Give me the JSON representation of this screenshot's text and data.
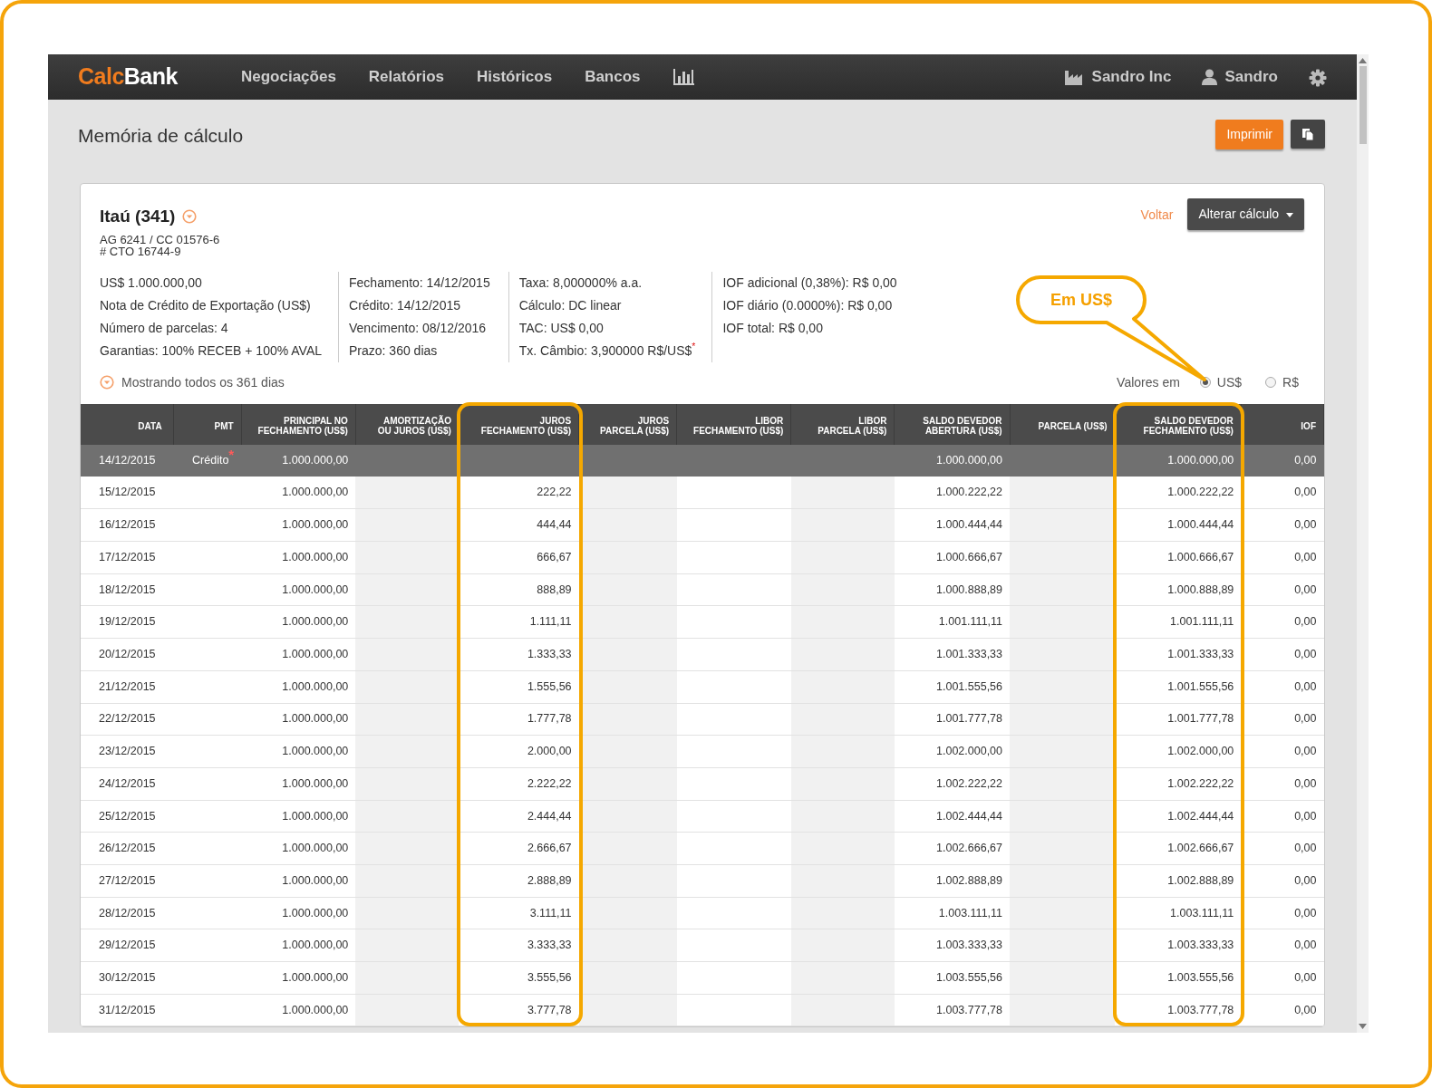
{
  "navbar": {
    "logo_accent": "Calc",
    "logo_rest": "Bank",
    "items": [
      {
        "label": "Negociações"
      },
      {
        "label": "Relatórios"
      },
      {
        "label": "Históricos"
      },
      {
        "label": "Bancos"
      }
    ],
    "company": "Sandro Inc",
    "user": "Sandro"
  },
  "page": {
    "title": "Memória de cálculo",
    "print_button": "Imprimir"
  },
  "bank": {
    "name": "Itaú (341)",
    "account": "AG 6241 / CC 01576-6",
    "contract": "# CTO 16744-9",
    "back_link": "Voltar",
    "change_button": "Alterar cálculo"
  },
  "details": [
    {
      "lines": [
        "US$ 1.000.000,00",
        "Nota de Crédito de Exportação (US$)",
        "Número de parcelas: 4",
        "Garantias: 100% RECEB + 100% AVAL"
      ]
    },
    {
      "lines": [
        "Fechamento: 14/12/2015",
        "Crédito: 14/12/2015",
        "Vencimento: 08/12/2016",
        "Prazo: 360 dias"
      ]
    },
    {
      "lines": [
        "Taxa: 8,000000% a.a.",
        "Cálculo: DC linear",
        "TAC: US$ 0,00",
        "Tx. Câmbio: 3,900000 R$/US$$^{*}$"
      ]
    },
    {
      "lines": [
        "IOF adicional (0,38%): R$ 0,00",
        "IOF diário (0.0000%): R$ 0,00",
        "IOF total: R$ 0,00"
      ]
    }
  ],
  "filter": {
    "label": "Mostrando todos os 361 dias"
  },
  "currency": {
    "label": "Valores em",
    "options": [
      {
        "label": "US$",
        "selected": true
      },
      {
        "label": "R$",
        "selected": false
      }
    ]
  },
  "callout": {
    "text": "Em US$"
  },
  "table": {
    "columns": [
      {
        "label": "DATA",
        "highlighted": false
      },
      {
        "label": "PMT",
        "highlighted": false
      },
      {
        "label": "PRINCIPAL NO\nFECHAMENTO (US$)",
        "highlighted": false
      },
      {
        "label": "AMORTIZAÇÃO\nOU JUROS (US$)",
        "highlighted": false
      },
      {
        "label": "JUROS\nFECHAMENTO (US$)",
        "highlighted": true
      },
      {
        "label": "JUROS\nPARCELA (US$)",
        "highlighted": false
      },
      {
        "label": "LIBOR\nFECHAMENTO (US$)",
        "highlighted": false
      },
      {
        "label": "LIBOR\nPARCELA (US$)",
        "highlighted": false
      },
      {
        "label": "SALDO DEVEDOR\nABERTURA (US$)",
        "highlighted": false
      },
      {
        "label": "PARCELA (US$)",
        "highlighted": false
      },
      {
        "label": "SALDO DEVEDOR\nFECHAMENTO (US$)",
        "highlighted": true
      },
      {
        "label": "IOF",
        "highlighted": false
      }
    ],
    "rows": [
      {
        "kind": "opening",
        "cells": [
          "14/12/2015",
          "Crédito$^{*}$",
          "1.000.000,00",
          null,
          null,
          null,
          null,
          null,
          "1.000.000,00",
          null,
          "1.000.000,00",
          "0,00"
        ]
      },
      {
        "kind": "day",
        "cells": [
          "15/12/2015",
          null,
          "1.000.000,00",
          null,
          "222,22",
          null,
          null,
          null,
          "1.000.222,22",
          null,
          "1.000.222,22",
          "0,00"
        ]
      },
      {
        "kind": "day",
        "cells": [
          "16/12/2015",
          null,
          "1.000.000,00",
          null,
          "444,44",
          null,
          null,
          null,
          "1.000.444,44",
          null,
          "1.000.444,44",
          "0,00"
        ]
      },
      {
        "kind": "day",
        "cells": [
          "17/12/2015",
          null,
          "1.000.000,00",
          null,
          "666,67",
          null,
          null,
          null,
          "1.000.666,67",
          null,
          "1.000.666,67",
          "0,00"
        ]
      },
      {
        "kind": "day",
        "cells": [
          "18/12/2015",
          null,
          "1.000.000,00",
          null,
          "888,89",
          null,
          null,
          null,
          "1.000.888,89",
          null,
          "1.000.888,89",
          "0,00"
        ]
      },
      {
        "kind": "day",
        "cells": [
          "19/12/2015",
          null,
          "1.000.000,00",
          null,
          "1.111,11",
          null,
          null,
          null,
          "1.001.111,11",
          null,
          "1.001.111,11",
          "0,00"
        ]
      },
      {
        "kind": "day",
        "cells": [
          "20/12/2015",
          null,
          "1.000.000,00",
          null,
          "1.333,33",
          null,
          null,
          null,
          "1.001.333,33",
          null,
          "1.001.333,33",
          "0,00"
        ]
      },
      {
        "kind": "day",
        "cells": [
          "21/12/2015",
          null,
          "1.000.000,00",
          null,
          "1.555,56",
          null,
          null,
          null,
          "1.001.555,56",
          null,
          "1.001.555,56",
          "0,00"
        ]
      },
      {
        "kind": "day",
        "cells": [
          "22/12/2015",
          null,
          "1.000.000,00",
          null,
          "1.777,78",
          null,
          null,
          null,
          "1.001.777,78",
          null,
          "1.001.777,78",
          "0,00"
        ]
      },
      {
        "kind": "day",
        "cells": [
          "23/12/2015",
          null,
          "1.000.000,00",
          null,
          "2.000,00",
          null,
          null,
          null,
          "1.002.000,00",
          null,
          "1.002.000,00",
          "0,00"
        ]
      },
      {
        "kind": "day",
        "cells": [
          "24/12/2015",
          null,
          "1.000.000,00",
          null,
          "2.222,22",
          null,
          null,
          null,
          "1.002.222,22",
          null,
          "1.002.222,22",
          "0,00"
        ]
      },
      {
        "kind": "day",
        "cells": [
          "25/12/2015",
          null,
          "1.000.000,00",
          null,
          "2.444,44",
          null,
          null,
          null,
          "1.002.444,44",
          null,
          "1.002.444,44",
          "0,00"
        ]
      },
      {
        "kind": "day",
        "cells": [
          "26/12/2015",
          null,
          "1.000.000,00",
          null,
          "2.666,67",
          null,
          null,
          null,
          "1.002.666,67",
          null,
          "1.002.666,67",
          "0,00"
        ]
      },
      {
        "kind": "day",
        "cells": [
          "27/12/2015",
          null,
          "1.000.000,00",
          null,
          "2.888,89",
          null,
          null,
          null,
          "1.002.888,89",
          null,
          "1.002.888,89",
          "0,00"
        ]
      },
      {
        "kind": "day",
        "cells": [
          "28/12/2015",
          null,
          "1.000.000,00",
          null,
          "3.111,11",
          null,
          null,
          null,
          "1.003.111,11",
          null,
          "1.003.111,11",
          "0,00"
        ]
      },
      {
        "kind": "day",
        "cells": [
          "29/12/2015",
          null,
          "1.000.000,00",
          null,
          "3.333,33",
          null,
          null,
          null,
          "1.003.333,33",
          null,
          "1.003.333,33",
          "0,00"
        ]
      },
      {
        "kind": "day",
        "cells": [
          "30/12/2015",
          null,
          "1.000.000,00",
          null,
          "3.555,56",
          null,
          null,
          null,
          "1.003.555,56",
          null,
          "1.003.555,56",
          "0,00"
        ]
      },
      {
        "kind": "day",
        "cells": [
          "31/12/2015",
          null,
          "1.000.000,00",
          null,
          "3.777,78",
          null,
          null,
          null,
          "1.003.777,78",
          null,
          "1.003.777,78",
          "0,00"
        ]
      }
    ]
  }
}
